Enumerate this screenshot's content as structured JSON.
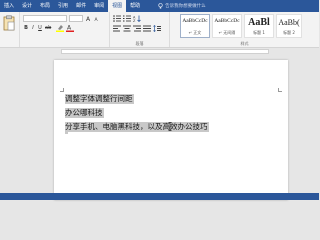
{
  "tabs": [
    "插入",
    "设计",
    "布局",
    "引用",
    "邮件",
    "审阅",
    "视图",
    "帮助"
  ],
  "active_tab": "视图",
  "tell_me": "告诉我你想要做什么",
  "font": {
    "name": "",
    "size": ""
  },
  "group_labels": {
    "paragraph": "段落",
    "styles": "样式"
  },
  "styles": [
    {
      "sample": "AaBbCcDc",
      "name": "↵ 正文"
    },
    {
      "sample": "AaBbCcDc",
      "name": "↵ 无间隔"
    },
    {
      "sample": "AaBl",
      "name": "标题 1"
    },
    {
      "sample": "AaBb(",
      "name": "标题 2"
    },
    {
      "sample": "AaBl",
      "name": "标题"
    }
  ],
  "document": {
    "lines": [
      "调整字体调整行间距",
      "办公哪科技",
      "分享手机、电脑黑科技，以及高效办公技巧"
    ],
    "empty_paragraph_mark": "↵"
  },
  "colors": {
    "accent": "#2b579a",
    "selection": "#c8c8c8"
  }
}
